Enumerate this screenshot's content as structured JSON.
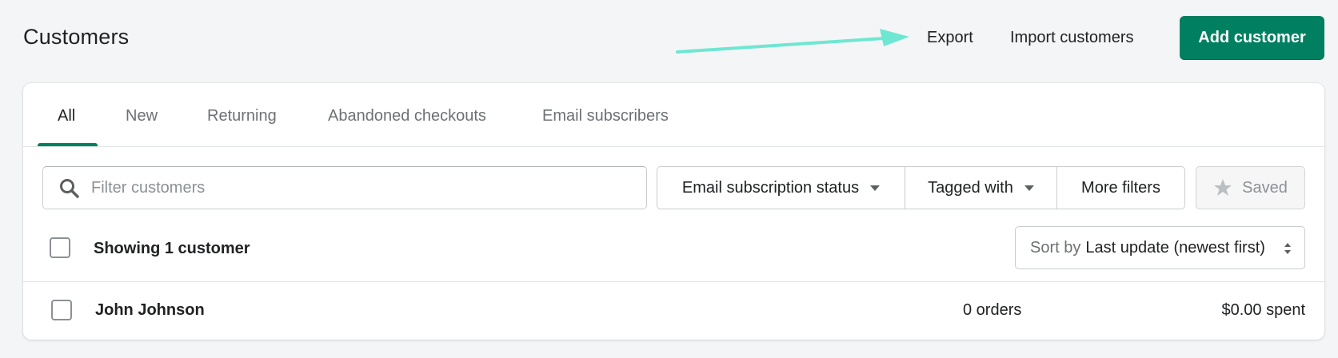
{
  "page": {
    "title": "Customers"
  },
  "header": {
    "export_label": "Export",
    "import_label": "Import customers",
    "add_label": "Add customer"
  },
  "tabs": [
    {
      "label": "All",
      "active": true
    },
    {
      "label": "New"
    },
    {
      "label": "Returning"
    },
    {
      "label": "Abandoned checkouts"
    },
    {
      "label": "Email subscribers"
    }
  ],
  "filters": {
    "search_placeholder": "Filter customers",
    "search_icon": "search-icon",
    "email_status_label": "Email subscription status",
    "tagged_label": "Tagged with",
    "more_label": "More filters",
    "saved_label": "Saved",
    "saved_icon": "star-icon"
  },
  "list": {
    "showing_label": "Showing 1 customer",
    "sort_prefix": "Sort by",
    "sort_value": "Last update (newest first)",
    "rows": [
      {
        "name": "John Johnson",
        "orders": "0 orders",
        "spent": "$0.00 spent"
      }
    ]
  },
  "colors": {
    "accent": "#008060",
    "annotation_arrow": "#6ee7d2",
    "background": "#f4f5f7"
  }
}
